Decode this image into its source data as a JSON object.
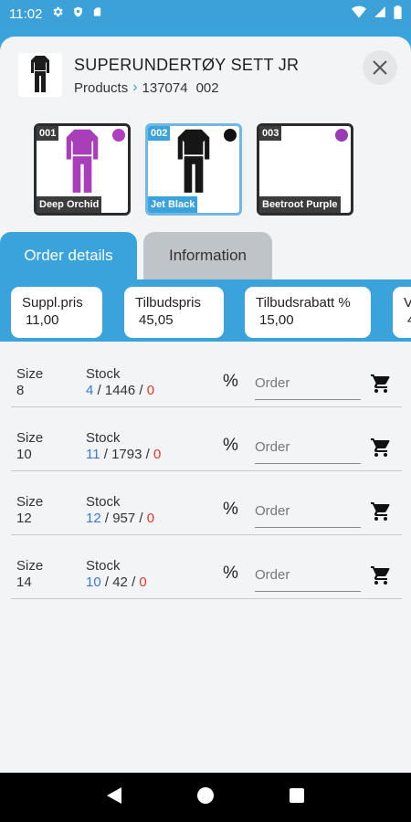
{
  "status_bar": {
    "time": "11:02"
  },
  "header": {
    "title": "SUPERUNDERTØY SETT JR",
    "breadcrumb_root": "Products",
    "product_number": "137074",
    "variant_code": "002"
  },
  "variants": [
    {
      "code": "001",
      "name": "Deep Orchid",
      "color": "#b03fc0",
      "selected": false
    },
    {
      "code": "002",
      "name": "Jet Black",
      "color": "#111111",
      "selected": true
    },
    {
      "code": "003",
      "name": "Beetroot Purple",
      "color": "#9a3bb5",
      "selected": false
    }
  ],
  "tabs": {
    "order_details": "Order details",
    "information": "Information"
  },
  "prices": [
    {
      "label": "Suppl.pris",
      "value": "11,00"
    },
    {
      "label": "Tilbudspris",
      "value": "45,05"
    },
    {
      "label": "Tilbudsrabatt %",
      "value": "15,00"
    },
    {
      "label": "V",
      "value": "4"
    }
  ],
  "rows": [
    {
      "size_label": "Size",
      "size": "8",
      "stock_label": "Stock",
      "stock_avail": "4",
      "stock_total": "1446",
      "stock_neg": "0",
      "order_placeholder": "Order"
    },
    {
      "size_label": "Size",
      "size": "10",
      "stock_label": "Stock",
      "stock_avail": "11",
      "stock_total": "1793",
      "stock_neg": "0",
      "order_placeholder": "Order"
    },
    {
      "size_label": "Size",
      "size": "12",
      "stock_label": "Stock",
      "stock_avail": "12",
      "stock_total": "957",
      "stock_neg": "0",
      "order_placeholder": "Order"
    },
    {
      "size_label": "Size",
      "size": "14",
      "stock_label": "Stock",
      "stock_avail": "10",
      "stock_total": "42",
      "stock_neg": "0",
      "order_placeholder": "Order"
    }
  ],
  "labels": {
    "percent_symbol": "%",
    "separator": "/"
  },
  "colors": {
    "accent": "#3aa3dc",
    "stock_available": "#3a79d8",
    "stock_negative": "#e0392b"
  }
}
